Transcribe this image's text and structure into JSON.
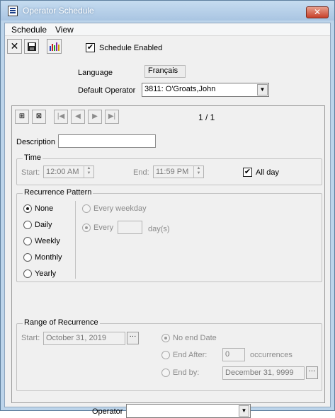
{
  "window": {
    "title": "Operator Schedule",
    "close_label": "✕"
  },
  "menu": {
    "items": [
      "Schedule",
      "View"
    ]
  },
  "toolbar": {
    "schedule_enabled_label": "Schedule Enabled",
    "schedule_enabled_checked": true
  },
  "settings": {
    "language_label": "Language",
    "language_value": "Français",
    "default_operator_label": "Default Operator",
    "default_operator_value": "3811: O'Groats,John"
  },
  "navigator": {
    "position": "1 / 1"
  },
  "entry": {
    "description_label": "Description",
    "description_value": "",
    "time": {
      "group_label": "Time",
      "start_label": "Start:",
      "start_value": "12:00 AM",
      "end_label": "End:",
      "end_value": "11:59 PM",
      "all_day_label": "All day",
      "all_day_checked": true
    },
    "recurrence": {
      "group_label": "Recurrence Pattern",
      "options": [
        "None",
        "Daily",
        "Weekly",
        "Monthly",
        "Yearly"
      ],
      "selected": "None",
      "every_weekday_label": "Every weekday",
      "every_label": "Every",
      "every_value": "",
      "days_label": "day(s)"
    },
    "range": {
      "group_label": "Range of Recurrence",
      "start_label": "Start:",
      "start_value": "October 31, 2019",
      "no_end_label": "No end Date",
      "end_after_label": "End After:",
      "end_after_value": "0",
      "occurrences_label": "occurrences",
      "end_by_label": "End by:",
      "end_by_value": "December 31, 9999"
    },
    "operator_label": "Operator",
    "operator_value": ""
  }
}
